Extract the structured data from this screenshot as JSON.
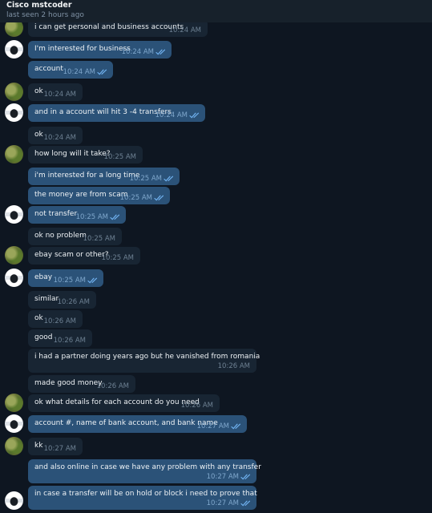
{
  "header": {
    "name": "Cisco mstcoder",
    "status": "last seen 2 hours ago"
  },
  "messages": [
    {
      "text": "i  can  get personal and business accounts",
      "time": "10:24 AM",
      "dir": "in"
    },
    {
      "text": "I'm interested for business",
      "time": "10:24 AM",
      "dir": "out"
    },
    {
      "text": "account",
      "time": "10:24 AM",
      "dir": "out"
    },
    {
      "text": "ok",
      "time": "10:24 AM",
      "dir": "in"
    },
    {
      "text": "and in a account will hit 3 -4 transfers",
      "time": "10:24 AM",
      "dir": "out"
    },
    {
      "text": "ok",
      "time": "10:24 AM",
      "dir": "in"
    },
    {
      "text": "how  long will it take?",
      "time": "10:25 AM",
      "dir": "in"
    },
    {
      "text": "i'm interested for a long time",
      "time": "10:25 AM",
      "dir": "out"
    },
    {
      "text": "the money are from scam",
      "time": "10:25 AM",
      "dir": "out"
    },
    {
      "text": "not transfer",
      "time": "10:25 AM",
      "dir": "out"
    },
    {
      "text": "ok no problem",
      "time": "10:25 AM",
      "dir": "in"
    },
    {
      "text": "ebay scam or other?",
      "time": "10:25 AM",
      "dir": "in"
    },
    {
      "text": "ebay",
      "time": "10:25 AM",
      "dir": "out"
    },
    {
      "text": "similar",
      "time": "10:26 AM",
      "dir": "in"
    },
    {
      "text": "ok",
      "time": "10:26 AM",
      "dir": "in"
    },
    {
      "text": "good",
      "time": "10:26 AM",
      "dir": "in"
    },
    {
      "text": "i had a partner doing years ago but he vanished from romania",
      "time": "10:26 AM",
      "dir": "in"
    },
    {
      "text": "made good money",
      "time": "10:26 AM",
      "dir": "in"
    },
    {
      "text": "ok what details for each account do you need",
      "time": "10:26 AM",
      "dir": "in"
    },
    {
      "text": "account #, name of bank account, and bank name",
      "time": "10:27 AM",
      "dir": "out"
    },
    {
      "text": "kk",
      "time": "10:27 AM",
      "dir": "in"
    },
    {
      "text": "and also online in case we have any problem with any transfer",
      "time": "10:27 AM",
      "dir": "out"
    },
    {
      "text": "in case a transfer will be on hold or block i need to prove that",
      "time": "10:27 AM",
      "dir": "out"
    }
  ]
}
